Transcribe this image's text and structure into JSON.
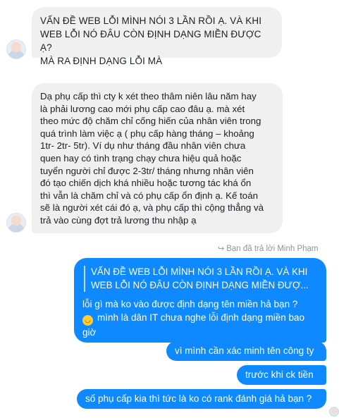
{
  "conversation": {
    "incoming": [
      {
        "lines": [
          "VẤN  ĐỀ WEB LỖI MÌNH NÓI 3 LẦN RỒI Ạ. VÀ KHI",
          "WEB LỖI NÓ ĐÂU CÒN ĐỊNH DẠNG MIỀN ĐƯỢC Ạ?",
          "MÀ RA ĐỊNH DẠNG LỖI MÀ"
        ]
      },
      {
        "lines": [
          "Dạ phụ cấp thì cty k xét theo thâm niên lâu năm hay",
          "là phải lương cao mới phụ cấp cao đâu ạ. mà xét",
          "theo mức độ chăm chỉ cống hiến của nhân viên trong",
          "quá trình làm việc ạ ( phụ cấp hàng tháng – khoảng",
          "1tr- 2tr- 5tr). Ví dụ như tháng đầu nhân viên chưa",
          "quen hay có tình trạng chạy chưa hiệu quả hoặc",
          "tuyển người chỉ được 2-3tr/ tháng nhưng nhân viên",
          "đó tạo chiến dịch khá nhiều hoặc tương tác khá ổn",
          "thì vẫn là chăm chỉ và có phụ cấp ổn định ạ. Kế toán",
          "sẽ là người xét cái đó ạ, và phụ cấp thì cộng thẳng và",
          "trả vào cùng đợt trả lương thu nhập ạ"
        ]
      }
    ],
    "reply_notice": {
      "icon": "reply-arrow-icon",
      "text": "Bạn đã trả lời Minh Phạm"
    },
    "outgoing_reply": {
      "quote_lines": [
        "VẤN ĐỀ WEB LỖI MÌNH NÓI 3 LẦN RỒI Ạ. VÀ KHI",
        "WEB LỖI NÓ ĐÂU CÒN ĐỊNH DẠNG MIỀN ĐƯỢ..."
      ],
      "line1": "lỗi gì mà ko vào được định dạng tên miền hả bạn ?",
      "emoji": "smile-emoji-icon",
      "line2": "mình là dân IT chưa nghe lỗi định dạng miền bao",
      "line3": "giờ"
    },
    "outgoing": [
      "vì mình cần xác minh tên công ty",
      "trước khi ck tiền",
      "số phụ cấp kia thì tức là ko có rank đánh giá hả bạn ?"
    ]
  },
  "colors": {
    "outgoing_bubble": "#0e89ff",
    "incoming_bubble": "#f1f0f0",
    "meta_text": "#8d949e"
  }
}
